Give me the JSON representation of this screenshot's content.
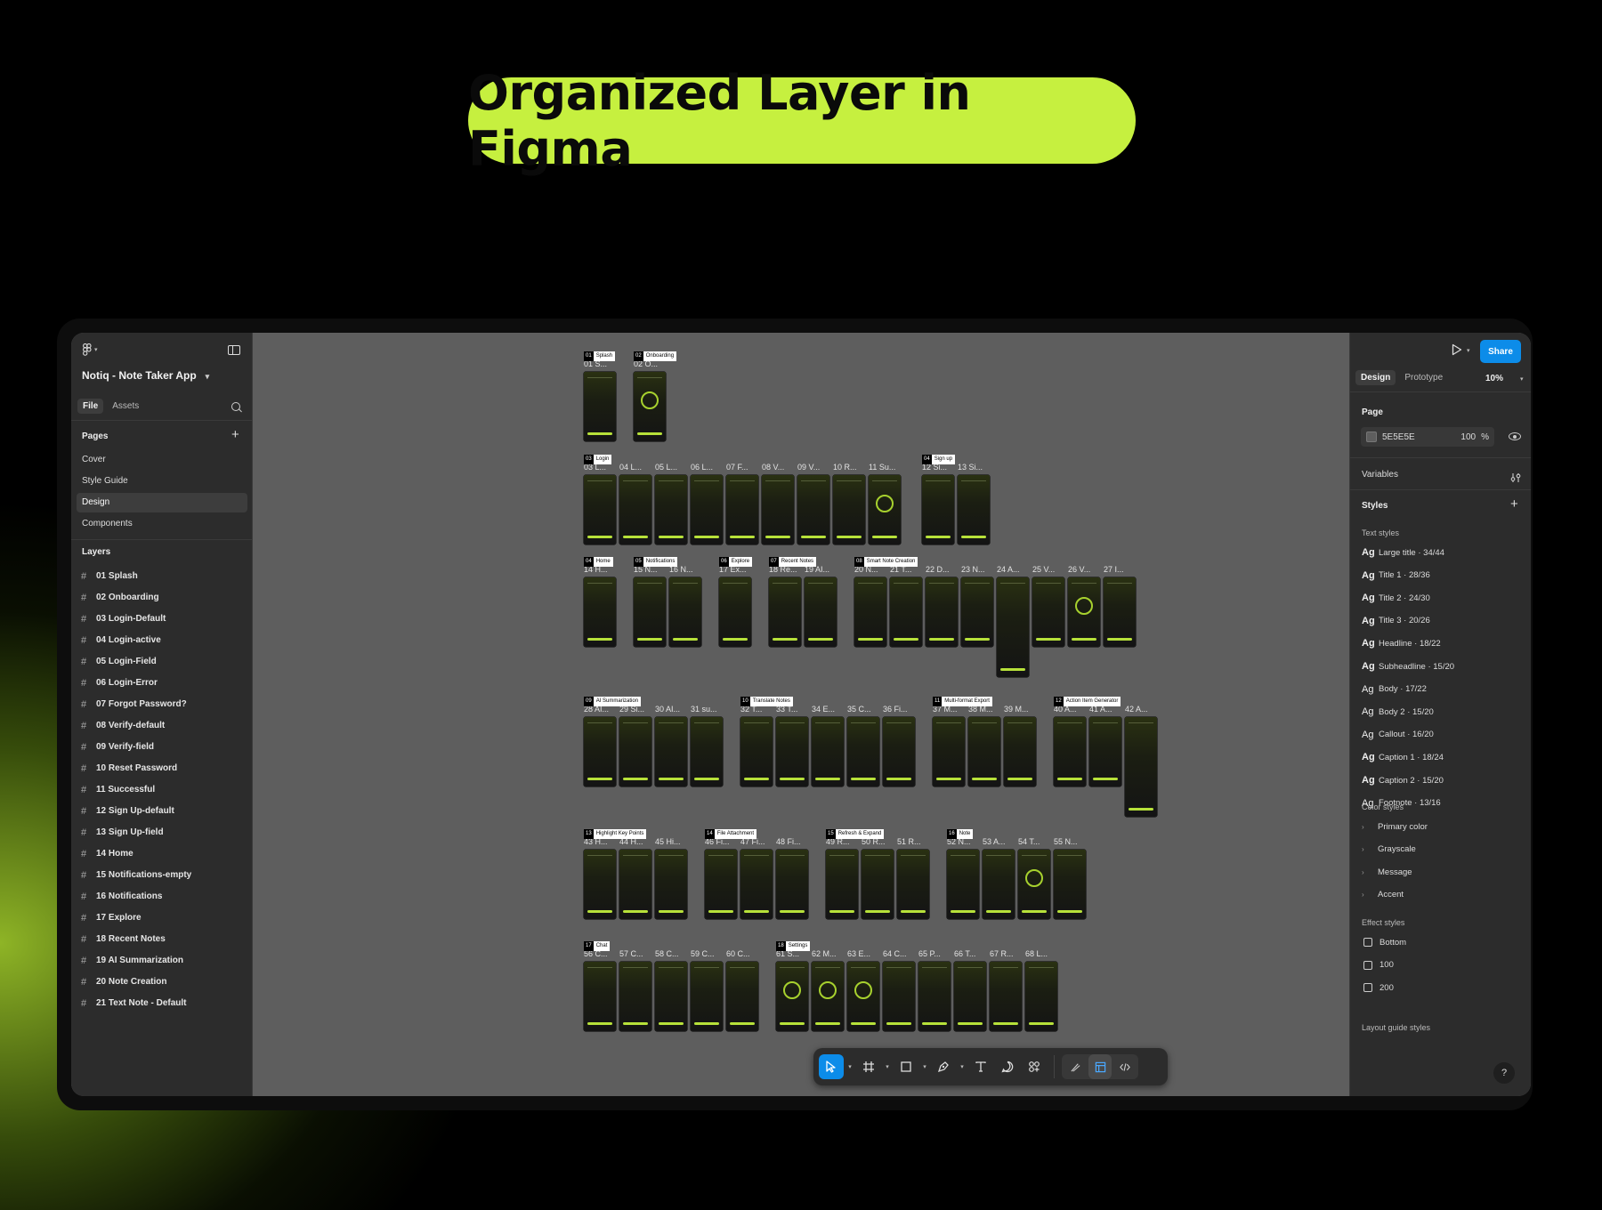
{
  "headline": "Organized Layer in Figma",
  "colors": {
    "accent": "#c6f03f",
    "canvas": "#5e5e5e",
    "panel": "#2c2c2c",
    "primary_button": "#0c8ce9"
  },
  "left_panel": {
    "file_name": "Notiq - Note Taker App",
    "tabs": [
      "File",
      "Assets"
    ],
    "pages_title": "Pages",
    "pages": [
      "Cover",
      "Style Guide",
      "Design",
      "Components"
    ],
    "active_page": "Design",
    "layers_title": "Layers",
    "layers": [
      "01 Splash",
      "02 Onboarding",
      "03 Login-Default",
      "04 Login-active",
      "05 Login-Field",
      "06 Login-Error",
      "07 Forgot Password?",
      "08 Verify-default",
      "09 Verify-field",
      "10 Reset Password",
      "11 Successful",
      "12 Sign Up-default",
      "13 Sign Up-field",
      "14 Home",
      "15 Notifications-empty",
      "16 Notifications",
      "17 Explore",
      "18 Recent Notes",
      "19 AI Summarization",
      "20 Note Creation",
      "21 Text Note - Default"
    ]
  },
  "canvas": {
    "section_tags": [
      {
        "num": "01",
        "name": "Splash"
      },
      {
        "num": "02",
        "name": "Onboarding"
      },
      {
        "num": "03",
        "name": "Login"
      },
      {
        "num": "04",
        "name": "Sign up"
      },
      {
        "num": "04",
        "name": "Home"
      },
      {
        "num": "05",
        "name": "Notifications"
      },
      {
        "num": "06",
        "name": "Explore"
      },
      {
        "num": "07",
        "name": "Recent Notes"
      },
      {
        "num": "08",
        "name": "Smart Note Creation"
      },
      {
        "num": "09",
        "name": "AI Summarization"
      },
      {
        "num": "10",
        "name": "Translate Notes"
      },
      {
        "num": "11",
        "name": "Multi-format Export"
      },
      {
        "num": "12",
        "name": "Action Item Generator"
      },
      {
        "num": "13",
        "name": "Highlight Key Points"
      },
      {
        "num": "14",
        "name": "File Attachment"
      },
      {
        "num": "15",
        "name": "Refresh & Expand"
      },
      {
        "num": "16",
        "name": "Note"
      },
      {
        "num": "17",
        "name": "Chat"
      },
      {
        "num": "18",
        "name": "Settings"
      }
    ],
    "frame_labels": [
      "01 S...",
      "02 O...",
      "03 L...",
      "04 L...",
      "05 L...",
      "06 L...",
      "07 F...",
      "08 V...",
      "09 V...",
      "10 R...",
      "11 Su...",
      "12 Si...",
      "13 Si...",
      "14 H...",
      "15 N...",
      "16 N...",
      "17 Ex...",
      "18 Re...",
      "19 AI...",
      "20 N...",
      "21 T...",
      "22 D...",
      "23 N...",
      "24 A...",
      "25 V...",
      "26 V...",
      "27 I...",
      "28 AI...",
      "29 Si...",
      "30 AI...",
      "31 su...",
      "32 T...",
      "33 T...",
      "34 E...",
      "35 C...",
      "36 Fi...",
      "37 M...",
      "38 M...",
      "39 M...",
      "40 A...",
      "41 A...",
      "42 A...",
      "43 H...",
      "44 H...",
      "45 Hi...",
      "46 Fi...",
      "47 Fi...",
      "48 Fi...",
      "49 R...",
      "50 R...",
      "51 R...",
      "52 N...",
      "53 A...",
      "54 T...",
      "55 N...",
      "56 C...",
      "57 C...",
      "58 C...",
      "59 C...",
      "60 C...",
      "61 S...",
      "62 M...",
      "63 E...",
      "64 C...",
      "65 P...",
      "66 T...",
      "67 R...",
      "68 L..."
    ]
  },
  "toolbar": {
    "tools": [
      "move-tool",
      "frame-tool",
      "shape-tool",
      "pen-tool",
      "text-tool",
      "comment-tool",
      "actions-tool"
    ],
    "modes": [
      "draw-mode",
      "design-mode",
      "dev-mode"
    ]
  },
  "right_panel": {
    "share_label": "Share",
    "tabs": [
      "Design",
      "Prototype"
    ],
    "zoom": "10%",
    "page_title": "Page",
    "page_color": "5E5E5E",
    "page_opacity": "100",
    "page_opacity_unit": "%",
    "variables_title": "Variables",
    "styles_title": "Styles",
    "text_styles_title": "Text styles",
    "text_styles": [
      "Large title · 34/44",
      "Title 1 · 28/36",
      "Title 2 · 24/30",
      "Title 3 · 20/26",
      "Headline · 18/22",
      "Subheadline · 15/20",
      "Body · 17/22",
      "Body 2 · 15/20",
      "Callout · 16/20",
      "Caption 1 · 18/24",
      "Caption 2 · 15/20",
      "Footnote · 13/16"
    ],
    "text_style_glyph": "Ag",
    "color_styles_title": "Color styles",
    "color_styles": [
      "Primary color",
      "Grayscale",
      "Message",
      "Accent"
    ],
    "effect_styles_title": "Effect styles",
    "effect_styles": [
      "Bottom",
      "100",
      "200"
    ],
    "layout_guide_title": "Layout guide styles",
    "help_label": "?"
  }
}
